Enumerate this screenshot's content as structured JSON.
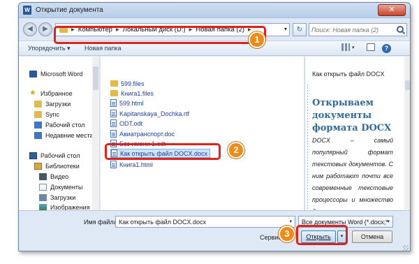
{
  "window": {
    "title": "Открытие документа",
    "close_glyph": "✕"
  },
  "nav": {
    "back_glyph": "◀",
    "forward_glyph": "▶"
  },
  "address": {
    "crumbs": [
      "Компьютер",
      "Локальный диск (D:)",
      "Новая папка (2)"
    ],
    "separator": "▸",
    "dropdown_glyph": "▾",
    "refresh_glyph": "↻"
  },
  "search": {
    "placeholder": "Поиск: Новая папка (2)"
  },
  "toolbar": {
    "organize": "Упорядочить ▾",
    "new_folder": "Новая папка",
    "view_drop": "▾",
    "help": "?"
  },
  "sidebar": {
    "items": [
      {
        "label": "Microsoft Word",
        "icon": "word-icon"
      },
      {
        "label": "Избранное",
        "icon": "star-icon"
      },
      {
        "label": "Загрузки",
        "icon": "downloads-folder-icon"
      },
      {
        "label": "Sync",
        "icon": "sync-folder-icon"
      },
      {
        "label": "Рабочий стол",
        "icon": "desktop-icon"
      },
      {
        "label": "Недавние места",
        "icon": "recent-places-icon"
      },
      {
        "label": "Рабочий стол",
        "icon": "desktop-icon"
      },
      {
        "label": "Библиотеки",
        "icon": "library-icon"
      },
      {
        "label": "Видео",
        "icon": "video-icon"
      },
      {
        "label": "Документы",
        "icon": "documents-icon"
      },
      {
        "label": "Загрузки",
        "icon": "downloads-icon"
      },
      {
        "label": "Изображения",
        "icon": "images-icon"
      }
    ]
  },
  "files": [
    {
      "name": "599.files",
      "icon": "folder-icon"
    },
    {
      "name": "Книга1.files",
      "icon": "folder-icon"
    },
    {
      "name": "599.html",
      "icon": "document-icon"
    },
    {
      "name": "Kapitanskaya_Dochka.rtf",
      "icon": "document-icon"
    },
    {
      "name": "ODT.odt",
      "icon": "document-icon"
    },
    {
      "name": "Авиатранспорт.doc",
      "icon": "document-icon"
    },
    {
      "name": "Без имени 1.odt",
      "icon": "document-icon"
    },
    {
      "name": "Как открыть файл DOCX.docx",
      "icon": "document-icon",
      "selected": true
    },
    {
      "name": "Книга1.html",
      "icon": "document-icon"
    }
  ],
  "preview": {
    "title": "Как открыть файл DOCX",
    "heading": "Открываем документы формата DOCX",
    "body": "DOCX – самый популярный формат текстовых документов. С ним работают почти все современные текстовые процессоры и множество других"
  },
  "footer": {
    "filename_label": "Имя файла:",
    "filename_value": "Как открыть файл DOCX.docx",
    "filter_value": "Все документы Word (*.docx;*",
    "service_label": "Сервис",
    "open_label": "Открыть",
    "cancel_label": "Отмена"
  },
  "callouts": [
    "1",
    "2",
    "3"
  ],
  "colors": {
    "callout": "#f28a16",
    "highlight_border": "#e3211b",
    "link": "#1a3f9e"
  }
}
